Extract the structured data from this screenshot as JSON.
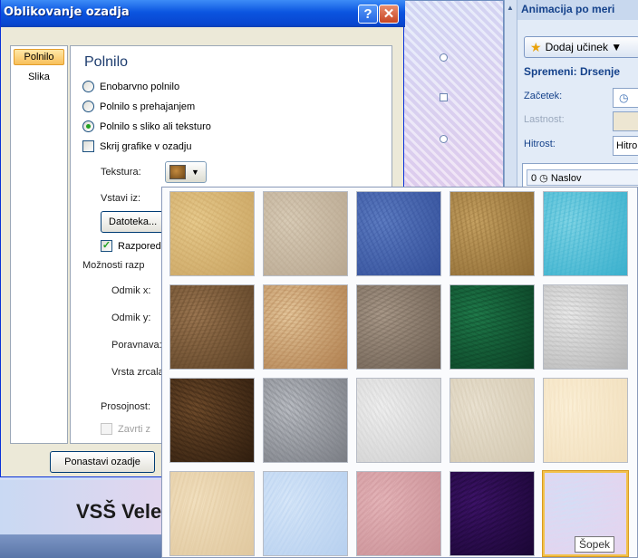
{
  "dialog": {
    "title": "Oblikovanje ozadja",
    "help_label": "?",
    "close_label": "✕",
    "nav": {
      "fill": "Polnilo",
      "picture": "Slika"
    },
    "section_title": "Polnilo",
    "options": {
      "solid": "Enobarvno polnilo",
      "gradient": "Polnilo s prehajanjem",
      "picture_texture": "Polnilo s sliko ali teksturo",
      "hide_graphics": "Skrij grafike v ozadju"
    },
    "texture_label": "Tekstura:",
    "insert_from_label": "Vstavi iz:",
    "file_button": "Datoteka...",
    "tile_checkbox": "Razporedi",
    "tiling_options_label": "Možnosti razp",
    "offset_x": "Odmik x:",
    "offset_y": "Odmik y:",
    "alignment": "Poravnava:",
    "mirror_type": "Vrsta zrcala:",
    "transparency": "Prosojnost:",
    "rotate_with_shape": "Zavrti z",
    "reset_button": "Ponastavi ozadje"
  },
  "slide": {
    "title": "VSŠ Vele"
  },
  "task_pane": {
    "title": "Animacija po meri",
    "add_effect": "Dodaj učinek ▼",
    "modify_header": "Spremeni: Drsenje",
    "start_label": "Začetek:",
    "property_label": "Lastnost:",
    "speed_label": "Hitrost:",
    "speed_value": "Hitro",
    "list_item": "0 ◷ Naslov"
  },
  "gallery": {
    "tooltip": "Šopek",
    "selected_index": 19,
    "textures": [
      {
        "name": "papyrus",
        "color": "#e6c98c",
        "color2": "#c9a462"
      },
      {
        "name": "canvas",
        "color": "#d8cbb6",
        "color2": "#b8a790"
      },
      {
        "name": "denim",
        "color": "#5d7cc1",
        "color2": "#34509a"
      },
      {
        "name": "woven-mat",
        "color": "#c4a061",
        "color2": "#8e6b34"
      },
      {
        "name": "water-droplets",
        "color": "#7fd3e4",
        "color2": "#3ab0cd"
      },
      {
        "name": "paper-bag",
        "color": "#9a7550",
        "color2": "#5e4327"
      },
      {
        "name": "fish-fossil",
        "color": "#e3c59a",
        "color2": "#b08050"
      },
      {
        "name": "sand",
        "color": "#a89888",
        "color2": "#6d5f52"
      },
      {
        "name": "green-marble",
        "color": "#1f7a4a",
        "color2": "#0b3f24"
      },
      {
        "name": "white-marble",
        "color": "#e8e8e8",
        "color2": "#b5b5b5"
      },
      {
        "name": "brown-marble",
        "color": "#6d4a2a",
        "color2": "#2f1d0e"
      },
      {
        "name": "granite",
        "color": "#b9bcc2",
        "color2": "#7a7d84"
      },
      {
        "name": "newsprint",
        "color": "#eeeeee",
        "color2": "#d0d0d0"
      },
      {
        "name": "recycled-paper",
        "color": "#e9e1d0",
        "color2": "#d3c8b1"
      },
      {
        "name": "parchment",
        "color": "#fbefd6",
        "color2": "#f1dfbd"
      },
      {
        "name": "stationery",
        "color": "#f1dfbe",
        "color2": "#e0c89f"
      },
      {
        "name": "blue-tissue-paper",
        "color": "#d6e6f8",
        "color2": "#b7d0ef"
      },
      {
        "name": "pink-tissue-paper",
        "color": "#e4b4b8",
        "color2": "#c99096"
      },
      {
        "name": "purple-mesh",
        "color": "#3d1368",
        "color2": "#1a0634"
      },
      {
        "name": "bouquet",
        "color": "#d3def6",
        "color2": "#e6d3ee"
      }
    ]
  }
}
